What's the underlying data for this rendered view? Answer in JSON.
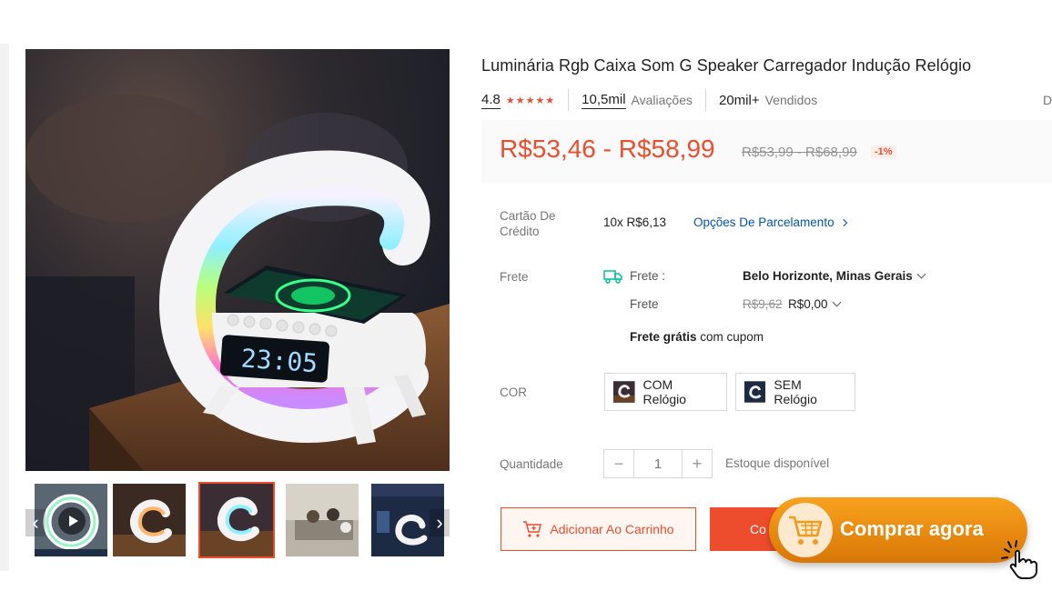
{
  "product": {
    "title": "Luminária Rgb Caixa Som G Speaker Carregador Indução Relógio",
    "rating": "4.8",
    "stars": "★★★★★",
    "reviews_count": "10,5mil",
    "reviews_label": "Avaliações",
    "sold_count": "20mil+",
    "sold_label": "Vendidos",
    "cut_text": "D"
  },
  "price": {
    "current": "R$53,46 - R$58,99",
    "original": "R$53,99 - R$68,99",
    "discount": "-1%"
  },
  "credit": {
    "label": "Cartão De Crédito",
    "value": "10x R$6,13",
    "link": "Opções De Parcelamento"
  },
  "shipping": {
    "label": "Frete",
    "to_label": "Frete :",
    "destination": "Belo Horizonte, Minas Gerais",
    "cost_label": "Frete",
    "cost_old": "R$9,62",
    "cost_new": "R$0,00",
    "free_bold": "Frete grátis",
    "free_rest": " com cupom"
  },
  "color": {
    "label": "COR",
    "options": [
      "COM Relógio",
      "SEM Relógio"
    ]
  },
  "quantity": {
    "label": "Quantidade",
    "value": "1",
    "minus": "−",
    "plus": "+",
    "stock": "Estoque disponível"
  },
  "actions": {
    "add_to_cart": "Adicionar Ao Carrinho",
    "buy_now_partial": "Co",
    "cta": "Comprar agora"
  },
  "gallery": {
    "display_time": "23:05",
    "thumb_count": 5,
    "active_thumb": 2
  },
  "colors": {
    "accent": "#ee4d2d",
    "cta_orange": "#f29a1a",
    "link": "#0055aa"
  },
  "icons": [
    "play-icon",
    "chevron-left-icon",
    "chevron-right-icon",
    "truck-icon",
    "chevron-down-icon",
    "cart-icon",
    "hand-pointer-icon"
  ]
}
